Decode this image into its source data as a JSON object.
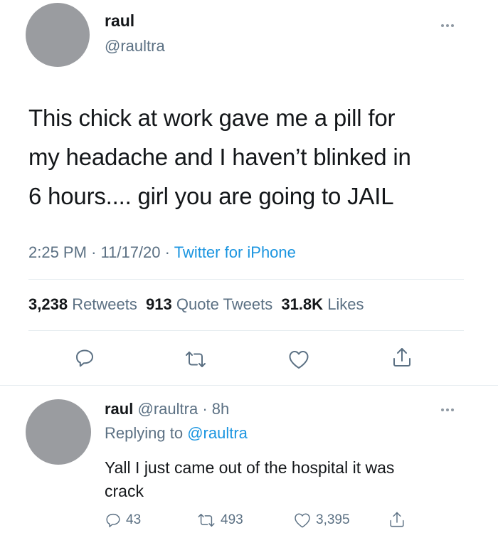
{
  "main_tweet": {
    "display_name": "raul",
    "handle": "@raultra",
    "text_line1": "This chick at work gave me a pill for",
    "text_line2": "my headache and I haven’t blinked in",
    "text_line3": "6 hours.... girl you are going to JAIL",
    "time": "2:25 PM",
    "date": "11/17/20",
    "sep": "·",
    "source": "Twitter for iPhone",
    "stats": {
      "retweets_count": "3,238",
      "retweets_label": "Retweets",
      "quotes_count": "913",
      "quotes_label": "Quote Tweets",
      "likes_count": "31.8K",
      "likes_label": "Likes"
    },
    "icons": [
      "reply-icon",
      "retweet-icon",
      "like-icon",
      "share-icon"
    ]
  },
  "reply_tweet": {
    "display_name": "raul",
    "handle": "@raultra",
    "sep": "·",
    "age": "8h",
    "replying_prefix": "Replying to",
    "replying_handle": "@raultra",
    "text_line1": "Yall I just came out of the hospital it was",
    "text_line2": "crack",
    "reply_count": "43",
    "retweet_count": "493",
    "like_count": "3,395"
  },
  "colors": {
    "text": "#14171a",
    "muted": "#5b7083",
    "link": "#1b95e0",
    "divider": "#e6ecf0",
    "avatar": "#9a9ca0"
  }
}
